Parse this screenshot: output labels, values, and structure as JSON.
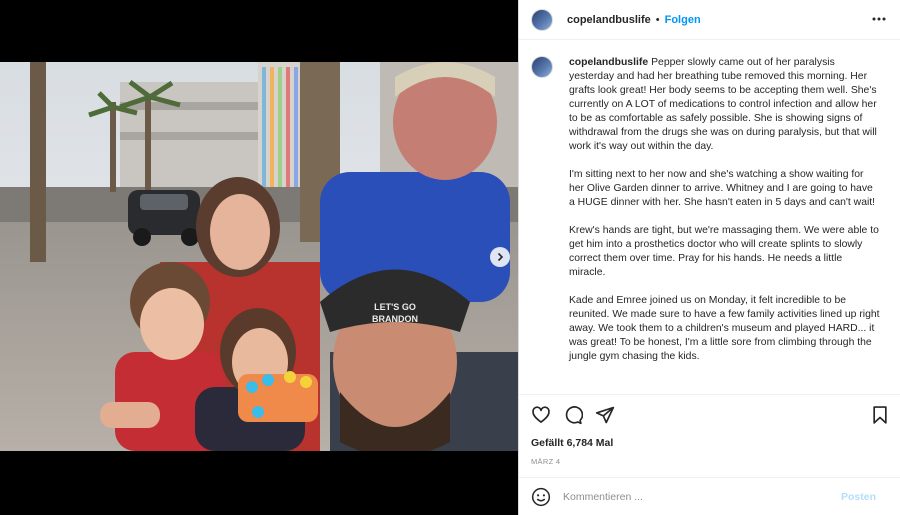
{
  "post": {
    "username": "copelandbuslife",
    "separator": "•",
    "follow_label": "Folgen",
    "caption_paragraphs": [
      "Pepper slowly came out of her paralysis yesterday and had her breathing tube removed this morning. Her grafts look great! Her body seems to be accepting them well. She's currently on A LOT of medications to control infection and allow her to be as comfortable as safely possible. She is showing signs of withdrawal from the drugs she was on during paralysis, but that will work it's way out within the day.",
      "I'm sitting next to her now and she's watching a show waiting for her Olive Garden dinner to arrive. Whitney and I are going to have a HUGE dinner with her. She hasn't eaten in 5 days and can't wait!",
      "Krew's hands are tight, but we're massaging them. We were able to get him into a prosthetics doctor who will create splints to slowly correct them over time. Pray for his hands. He needs a little miracle.",
      "Kade and Emree joined us on Monday, it felt incredible to be reunited. We made sure to have a few family activities lined up right away. We took them to a children's museum and played HARD... it was great! To be honest, I'm a little sore from climbing through the jungle gym chasing the kids."
    ],
    "likes": "Gefällt 6,784 Mal",
    "date": "MÄRZ 4",
    "comment_placeholder": "Kommentieren ...",
    "post_label": "Posten",
    "hat_text_1": "LET'S GO",
    "hat_text_2": "BRANDON"
  },
  "colors": {
    "link_blue": "#0095f6",
    "post_disabled": "#b2dffc",
    "text_primary": "#262626",
    "text_secondary": "#8e8e8e"
  },
  "icons": {
    "more": "more-options-icon",
    "like": "heart-icon",
    "comment": "comment-icon",
    "share": "paper-plane-icon",
    "save": "bookmark-icon",
    "emoji": "emoji-icon",
    "next": "chevron-right-icon"
  }
}
